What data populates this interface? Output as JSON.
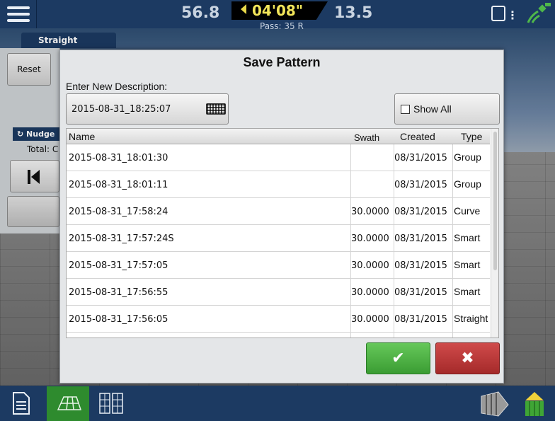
{
  "topbar": {
    "speed_left": "56.8",
    "timer": "04'08\"",
    "speed_right": "13.5",
    "pass": "Pass: 35 R"
  },
  "guidance": {
    "mode_tab": "Straight",
    "reset_label": "Reset",
    "nudge_label": "Nudge",
    "total_label": "Total: C"
  },
  "dialog": {
    "title": "Save Pattern",
    "description_label": "Enter New Description:",
    "description_value": "2015-08-31_18:25:07",
    "show_all_label": "Show All",
    "columns": {
      "name": "Name",
      "swath": "Swath",
      "created": "Created",
      "type": "Type"
    },
    "rows": [
      {
        "name": "2015-08-31_18:01:30",
        "swath": "",
        "created": "08/31/2015",
        "type": "Group"
      },
      {
        "name": "2015-08-31_18:01:11",
        "swath": "",
        "created": "08/31/2015",
        "type": "Group"
      },
      {
        "name": "2015-08-31_17:58:24",
        "swath": "30.0000",
        "created": "08/31/2015",
        "type": "Curve"
      },
      {
        "name": "2015-08-31_17:57:24S",
        "swath": "30.0000",
        "created": "08/31/2015",
        "type": "Smart"
      },
      {
        "name": "2015-08-31_17:57:05",
        "swath": "30.0000",
        "created": "08/31/2015",
        "type": "Smart"
      },
      {
        "name": "2015-08-31_17:56:55",
        "swath": "30.0000",
        "created": "08/31/2015",
        "type": "Smart"
      },
      {
        "name": "2015-08-31_17:56:05",
        "swath": "30.0000",
        "created": "08/31/2015",
        "type": "Straight"
      }
    ],
    "ok_symbol": "✔",
    "cancel_symbol": "✖"
  },
  "colors": {
    "bar_navy": "#1c3a62",
    "ok_green": "#3a9c33",
    "cancel_red": "#a52a2a",
    "timer_yellow": "#f3e65a"
  },
  "icons": [
    "menu-icon",
    "timer-arrow-icon",
    "device-icon",
    "gps-satellite-icon",
    "keyboard-icon",
    "checkbox-icon",
    "skip-back-icon",
    "document-icon",
    "map-view-icon",
    "split-view-icon",
    "coverage-icon",
    "tractor-icon"
  ]
}
